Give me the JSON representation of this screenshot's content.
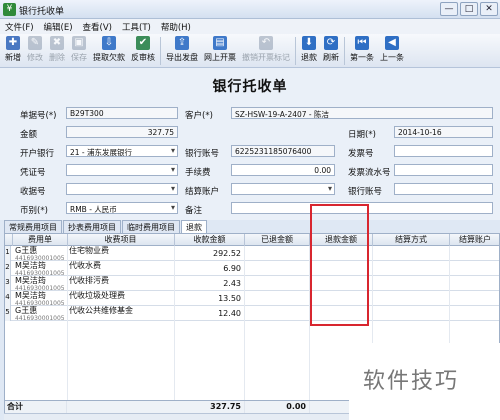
{
  "window": {
    "title": "银行托收单",
    "controls": [
      "—",
      "□",
      "✕"
    ]
  },
  "menu": [
    "文件(F)",
    "编辑(E)",
    "查看(V)",
    "工具(T)",
    "帮助(H)"
  ],
  "toolbar": [
    {
      "label": "新增",
      "icon": "new-icon",
      "color": "#4a78c2",
      "glyph": "✚",
      "enabled": true
    },
    {
      "label": "修改",
      "icon": "edit-icon",
      "color": "#7a8aa0",
      "glyph": "✎",
      "enabled": false
    },
    {
      "label": "删除",
      "icon": "delete-icon",
      "color": "#7a8aa0",
      "glyph": "✖",
      "enabled": false
    },
    {
      "label": "保存",
      "icon": "save-icon",
      "color": "#7a8aa0",
      "glyph": "▣",
      "enabled": false
    },
    {
      "label": "提取欠款",
      "icon": "extract-icon",
      "color": "#3f79c9",
      "glyph": "⇩",
      "enabled": true
    },
    {
      "label": "反审核",
      "icon": "unaudit-icon",
      "color": "#3c8d5a",
      "glyph": "✔",
      "enabled": true
    },
    {
      "label": "导出发盘",
      "icon": "export-icon",
      "color": "#3f79c9",
      "glyph": "⇪",
      "enabled": true
    },
    {
      "label": "网上开票",
      "icon": "invoice-icon",
      "color": "#3f79c9",
      "glyph": "▤",
      "enabled": true
    },
    {
      "label": "撤销开票标记",
      "icon": "undo-icon",
      "color": "#7a8aa0",
      "glyph": "↶",
      "enabled": false
    },
    {
      "label": "退款",
      "icon": "refund-icon",
      "color": "#2f6fc4",
      "glyph": "⬇",
      "enabled": true
    },
    {
      "label": "刷新",
      "icon": "refresh-icon",
      "color": "#2f6fc4",
      "glyph": "⟳",
      "enabled": true
    },
    {
      "label": "第一条",
      "icon": "first-icon",
      "color": "#2f6fc4",
      "glyph": "⏮",
      "enabled": true
    },
    {
      "label": "上一条",
      "icon": "prev-icon",
      "color": "#2f6fc4",
      "glyph": "◀",
      "enabled": true
    }
  ],
  "form": {
    "title": "银行托收单",
    "doc_no_label": "单据号(*)",
    "doc_no": "B29T300",
    "customer_label": "客户(*)",
    "customer": "SZ-HSW-19-A-2407 - 陈洁",
    "amount_label": "金额",
    "amount": "327.75",
    "date_label": "日期(*)",
    "date": "2014-10-16",
    "bank_label": "开户银行",
    "bank": "21 - 浦东发展银行",
    "account_label": "银行账号",
    "account": "6225231185076400",
    "invoice_no_label": "发票号",
    "invoice_no": "",
    "voucher_label": "凭证号",
    "voucher": "",
    "fee_label": "手续费",
    "fee": "0.00",
    "invoice_seq_label": "发票流水号",
    "invoice_seq": "",
    "receipt_label": "收据号",
    "receipt": "",
    "settle_account_label": "结算账户",
    "settle_account": "",
    "bank_acct2_label": "银行账号",
    "bank_acct2": "",
    "currency_label": "币别(*)",
    "currency": "RMB - 人民币",
    "remark_label": "备注",
    "remark": ""
  },
  "tabs": [
    "常规费用项目",
    "抄表费用项目",
    "临时费用项目",
    "退款"
  ],
  "active_tab": 3,
  "grid": {
    "columns": [
      "费用单",
      "收费项目",
      "收款金额",
      "已退金额",
      "退款金额",
      "结算方式",
      "结算账户"
    ],
    "rows": [
      {
        "no": "1",
        "bill": "G王惠",
        "bill_sub": "4416930001005",
        "item": "住宅物业费",
        "amount": "292.52"
      },
      {
        "no": "2",
        "bill": "M吴洁筠",
        "bill_sub": "4416930001005",
        "item": "代收水费",
        "amount": "6.90"
      },
      {
        "no": "3",
        "bill": "M吴洁筠",
        "bill_sub": "4416930001005",
        "item": "代收排污费",
        "amount": "2.43"
      },
      {
        "no": "4",
        "bill": "M吴洁筠",
        "bill_sub": "4416930001005",
        "item": "代收垃圾处理费",
        "amount": "13.50"
      },
      {
        "no": "5",
        "bill": "G王惠",
        "bill_sub": "4416930001005",
        "item": "代收公共维修基金",
        "amount": "12.40"
      }
    ],
    "footer": {
      "label": "合计",
      "amount": "327.75",
      "refunded": "0.00"
    }
  },
  "watermark": "软件技巧",
  "colors": {
    "highlight": "#d8262f",
    "window_bg": "#dfe8f4"
  }
}
